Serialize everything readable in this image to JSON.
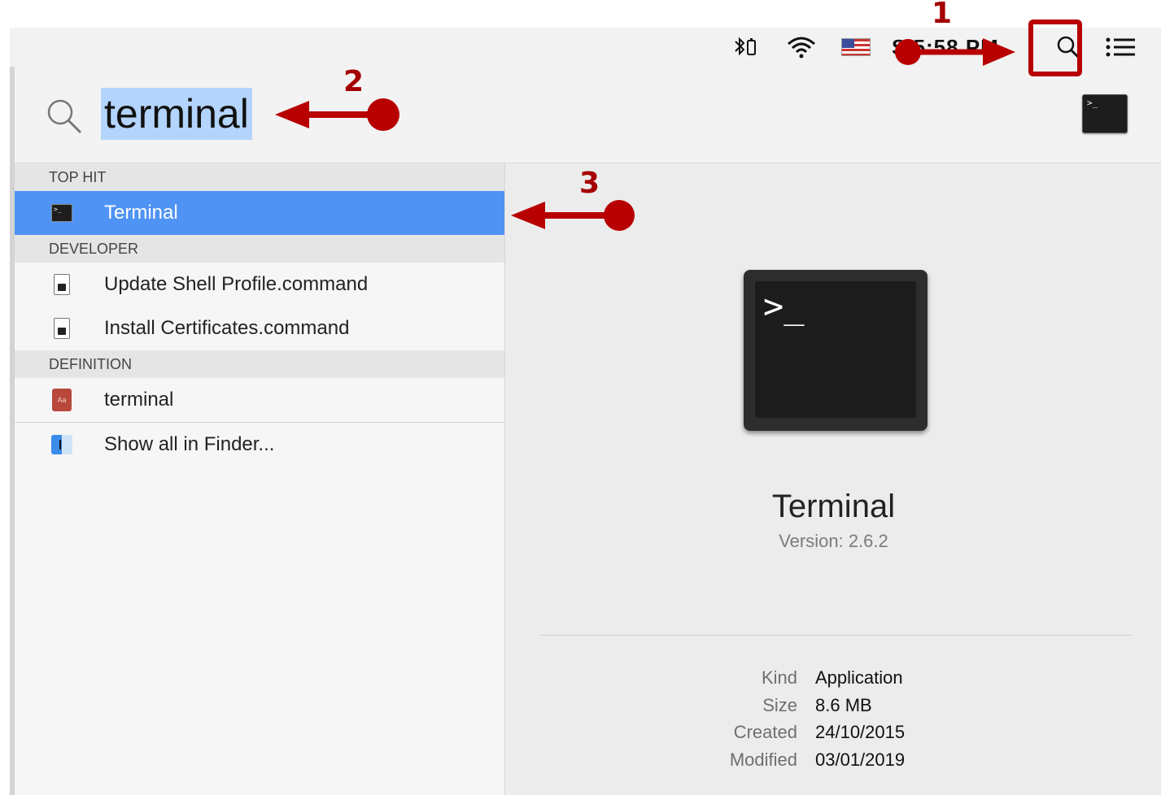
{
  "menubar": {
    "clock": "S 5:58 PM",
    "icons": [
      "bluetooth-battery-icon",
      "wifi-icon",
      "us-flag-icon",
      "spotlight-search-icon",
      "notification-list-icon"
    ]
  },
  "spotlight": {
    "query": "terminal",
    "sections": {
      "top_hit": "TOP HIT",
      "developer": "DEVELOPER",
      "definition": "DEFINITION"
    },
    "results": {
      "terminal_app": "Terminal",
      "update_shell": "Update Shell Profile.command",
      "install_certs": "Install Certificates.command",
      "definition": "terminal",
      "show_finder": "Show all in Finder..."
    },
    "preview": {
      "name": "Terminal",
      "version": "Version: 2.6.2",
      "details": [
        {
          "key": "Kind",
          "value": "Application"
        },
        {
          "key": "Size",
          "value": "8.6 MB"
        },
        {
          "key": "Created",
          "value": "24/10/2015"
        },
        {
          "key": "Modified",
          "value": "03/01/2019"
        }
      ],
      "prompt_glyph": ">_"
    }
  },
  "annotations": {
    "step1": "1",
    "step2": "2",
    "step3": "3",
    "color": "#b80000"
  },
  "colors": {
    "selection": "#4f94f5",
    "query_highlight": "#b3d4fc"
  }
}
